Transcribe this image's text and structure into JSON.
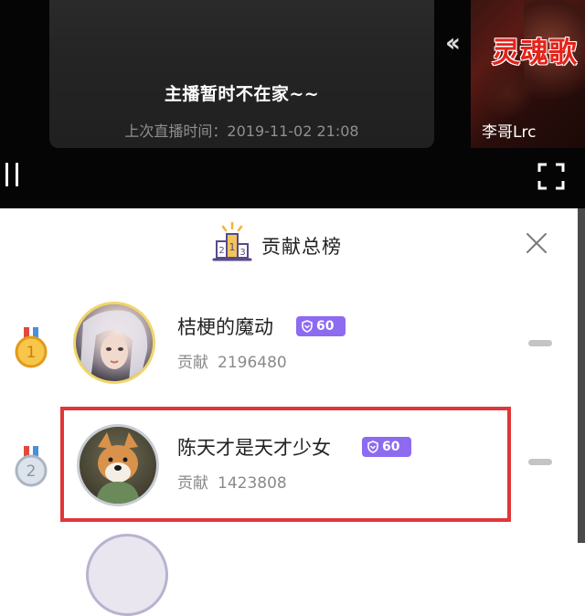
{
  "video": {
    "offline_message": "主播暂时不在家~~",
    "last_live": "上次直播时间：2019-11-02 21:08",
    "prev_arrow": "‹‹",
    "side_card_title": "灵魂歌",
    "side_card_name": "李哥Lrc"
  },
  "panel": {
    "title": "贡献总榜",
    "contribution_label": "贡献"
  },
  "ranking": [
    {
      "rank": "1",
      "name": "桔梗的魔动",
      "level": "60",
      "contribution": "2196480",
      "medal_color": "#f2b533"
    },
    {
      "rank": "2",
      "name": "陈天才是天才少女",
      "level": "60",
      "contribution": "1423808",
      "medal_color": "#b9c4cf"
    }
  ],
  "colors": {
    "accent_orange": "#ff6a1b",
    "level_badge": "#8d6bf1",
    "highlight_border": "#e0363a"
  },
  "icons": [
    "podium-icon",
    "close-icon",
    "pause-icon",
    "fullscreen-icon",
    "medal-icon",
    "shield-icon"
  ]
}
